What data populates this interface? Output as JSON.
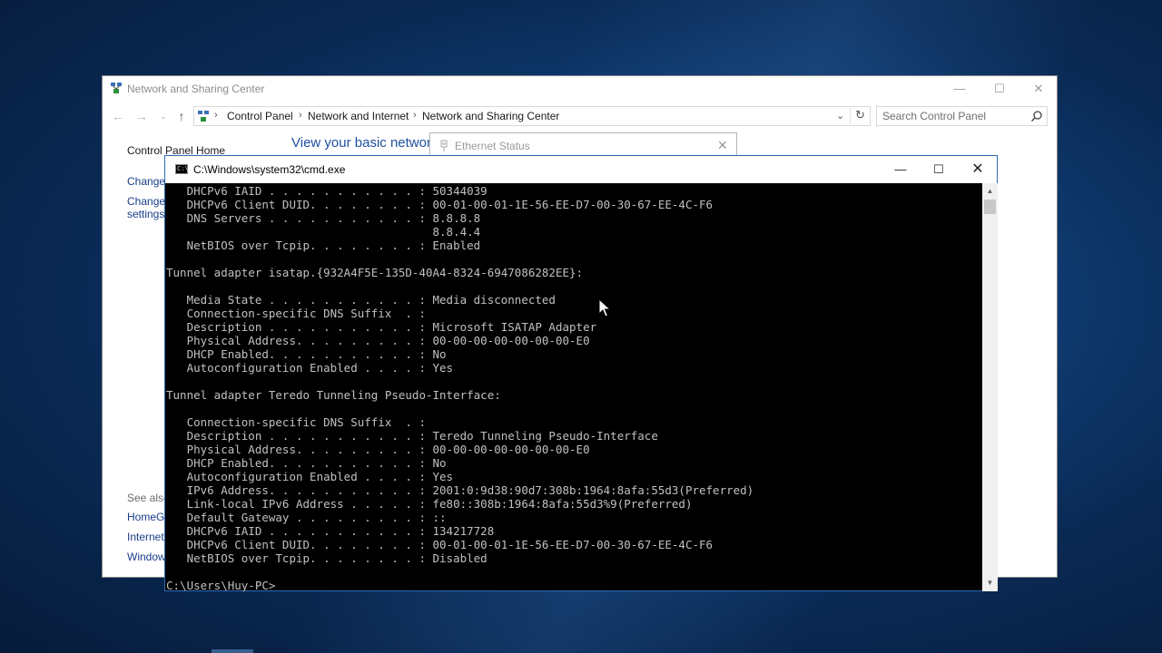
{
  "network_window": {
    "title": "Network and Sharing Center",
    "breadcrumbs": [
      "Control Panel",
      "Network and Internet",
      "Network and Sharing Center"
    ],
    "search_placeholder": "Search Control Panel",
    "sidebar": {
      "home": "Control Panel Home",
      "change1": "Change",
      "change2": "Change",
      "settings": "settings",
      "see_also": "See also",
      "homegroup": "HomeGr",
      "internet": "Internet",
      "windows": "Window"
    },
    "heading": "View your basic networ"
  },
  "ethernet_dialog": {
    "title": "Ethernet Status"
  },
  "cmd_window": {
    "title": "C:\\Windows\\system32\\cmd.exe",
    "icon_label": "C:\\",
    "lines": [
      "   DHCPv6 IAID . . . . . . . . . . . : 50344039",
      "   DHCPv6 Client DUID. . . . . . . . : 00-01-00-01-1E-56-EE-D7-00-30-67-EE-4C-F6",
      "   DNS Servers . . . . . . . . . . . : 8.8.8.8",
      "                                       8.8.4.4",
      "   NetBIOS over Tcpip. . . . . . . . : Enabled",
      "",
      "Tunnel adapter isatap.{932A4F5E-135D-40A4-8324-6947086282EE}:",
      "",
      "   Media State . . . . . . . . . . . : Media disconnected",
      "   Connection-specific DNS Suffix  . :",
      "   Description . . . . . . . . . . . : Microsoft ISATAP Adapter",
      "   Physical Address. . . . . . . . . : 00-00-00-00-00-00-00-E0",
      "   DHCP Enabled. . . . . . . . . . . : No",
      "   Autoconfiguration Enabled . . . . : Yes",
      "",
      "Tunnel adapter Teredo Tunneling Pseudo-Interface:",
      "",
      "   Connection-specific DNS Suffix  . :",
      "   Description . . . . . . . . . . . : Teredo Tunneling Pseudo-Interface",
      "   Physical Address. . . . . . . . . : 00-00-00-00-00-00-00-E0",
      "   DHCP Enabled. . . . . . . . . . . : No",
      "   Autoconfiguration Enabled . . . . : Yes",
      "   IPv6 Address. . . . . . . . . . . : 2001:0:9d38:90d7:308b:1964:8afa:55d3(Preferred)",
      "   Link-local IPv6 Address . . . . . : fe80::308b:1964:8afa:55d3%9(Preferred)",
      "   Default Gateway . . . . . . . . . : ::",
      "   DHCPv6 IAID . . . . . . . . . . . : 134217728",
      "   DHCPv6 Client DUID. . . . . . . . : 00-01-00-01-1E-56-EE-D7-00-30-67-EE-4C-F6",
      "   NetBIOS over Tcpip. . . . . . . . : Disabled",
      "",
      "C:\\Users\\Huy-PC>"
    ]
  },
  "icons": {
    "nav_back": "←",
    "nav_forward": "→",
    "nav_recent": "⌄",
    "nav_up": "↑",
    "address_dropdown": "⌄",
    "refresh": "↻",
    "minimize": "—",
    "maximize": "☐",
    "close": "✕",
    "scroll_up": "▲",
    "scroll_down": "▼"
  }
}
